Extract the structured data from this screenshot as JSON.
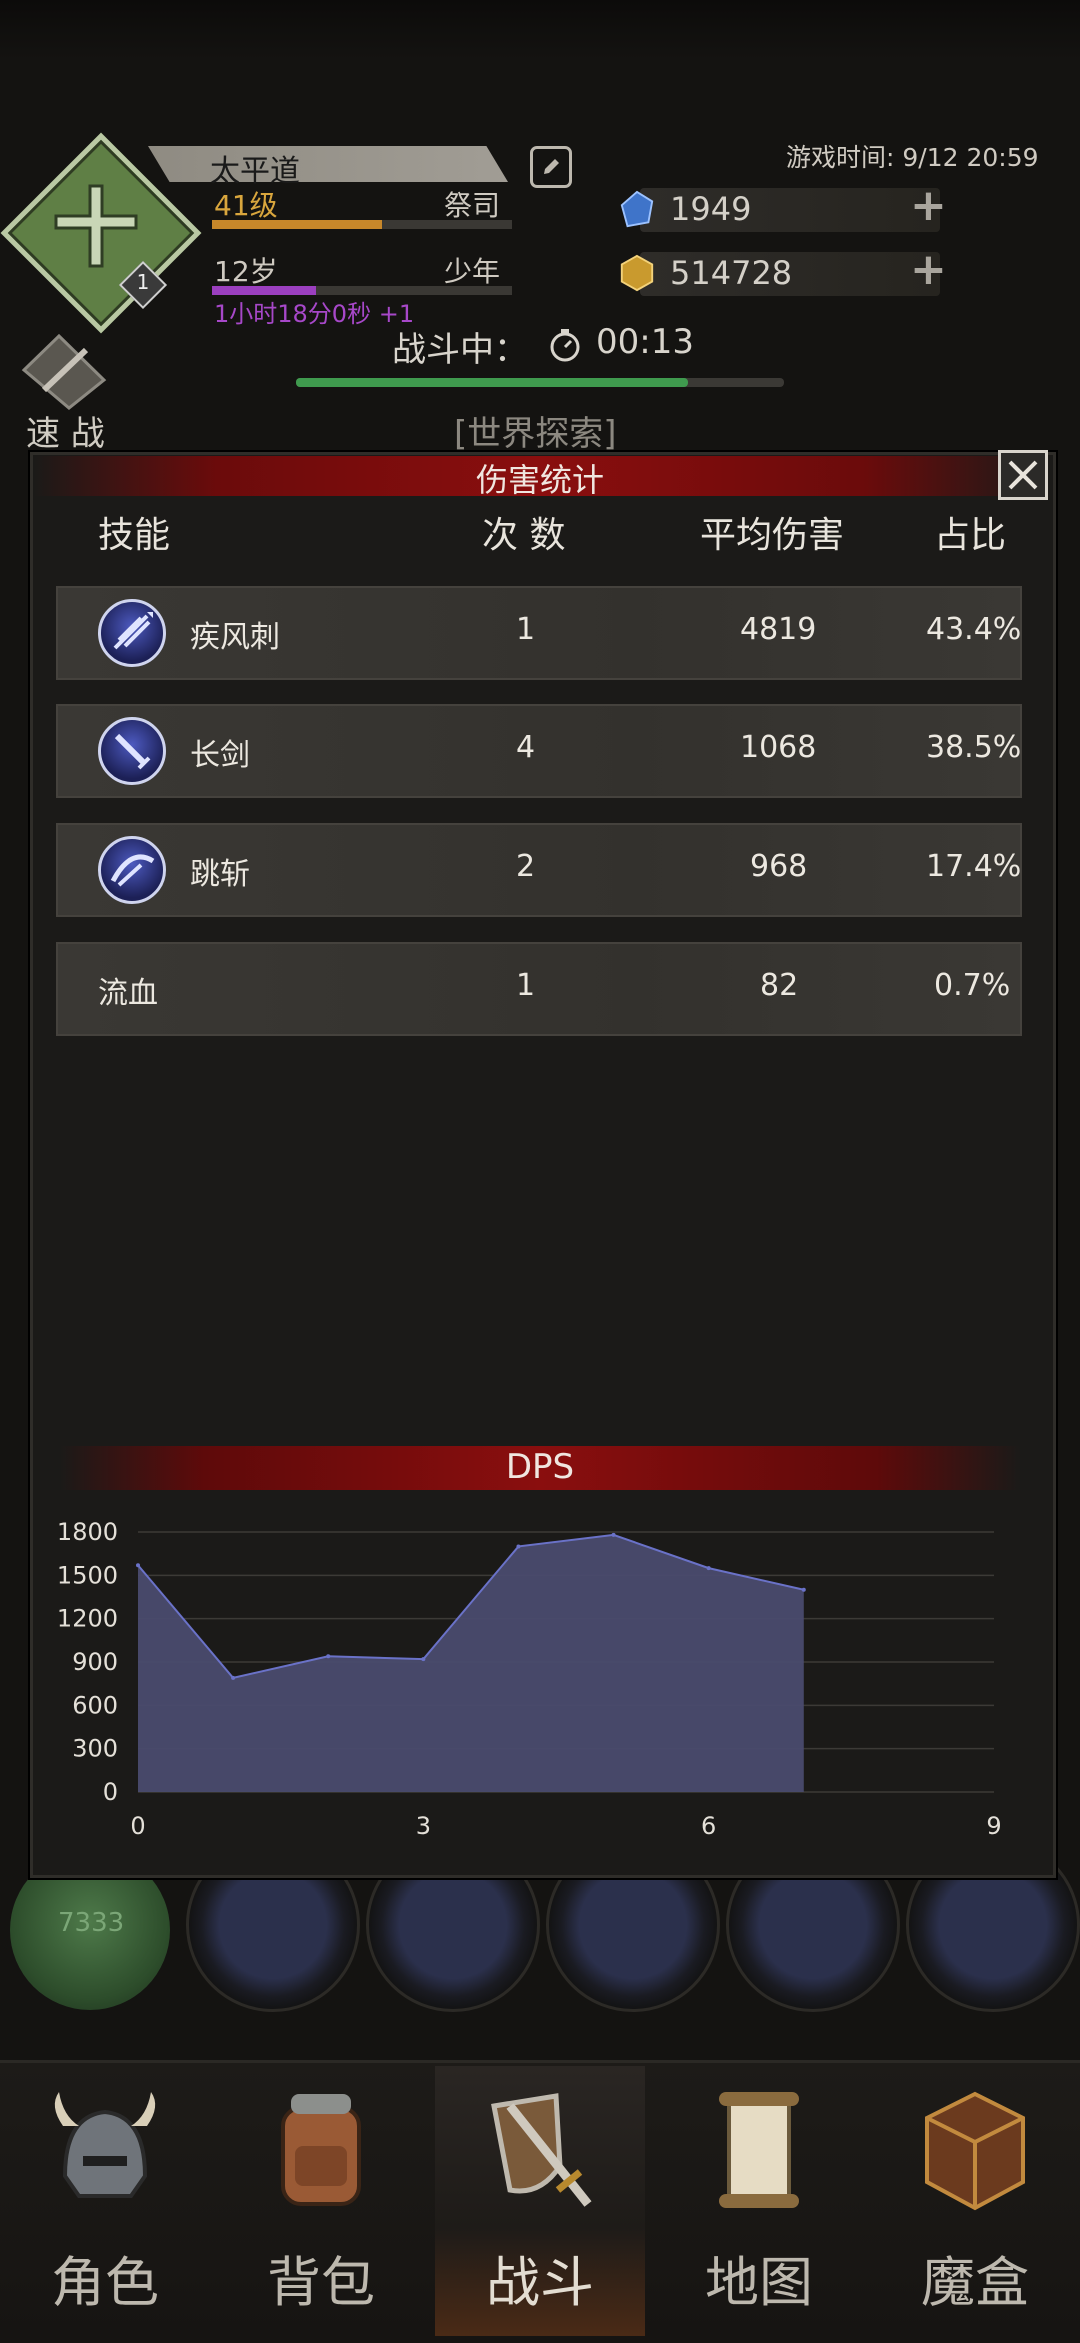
{
  "header": {
    "character_name": "太平道",
    "level": "41级",
    "class": "祭司",
    "age": "12岁",
    "age_stage": "少年",
    "age_timer": "1小时18分0秒 +1",
    "badge_level": "1",
    "game_time": "游戏时间: 9/12 20:59",
    "gems": "1949",
    "gold": "514728",
    "battle_state": "战斗中：",
    "battle_time": "00:13",
    "quick_battle": "速 战",
    "world_explore": "[世界探索]"
  },
  "damage_stats": {
    "title": "伤害统计",
    "columns": {
      "skill": "技能",
      "count": "次 数",
      "avg_damage": "平均伤害",
      "ratio": "占比"
    },
    "rows": [
      {
        "skill": "疾风刺",
        "count": "1",
        "avg": "4819",
        "ratio": "43.4%",
        "icon": "wind-thrust-icon"
      },
      {
        "skill": "长剑",
        "count": "4",
        "avg": "1068",
        "ratio": "38.5%",
        "icon": "longsword-icon"
      },
      {
        "skill": "跳斩",
        "count": "2",
        "avg": "968",
        "ratio": "17.4%",
        "icon": "leap-slash-icon"
      },
      {
        "skill": "流血",
        "count": "1",
        "avg": "82",
        "ratio": "0.7%",
        "icon": ""
      }
    ]
  },
  "chart_data": {
    "type": "area",
    "title": "DPS",
    "xlabel": "",
    "ylabel": "",
    "x": [
      0,
      1,
      2,
      3,
      4,
      5,
      6,
      7
    ],
    "values": [
      1570,
      790,
      940,
      920,
      1700,
      1780,
      1550,
      1400
    ],
    "xlim": [
      0,
      9
    ],
    "ylim": [
      0,
      1800
    ],
    "xticks": [
      0,
      3,
      6,
      9
    ],
    "yticks": [
      0,
      300,
      600,
      900,
      1200,
      1500,
      1800
    ],
    "grid": true,
    "color": "#4a4b6e",
    "line_color": "#6a72c8"
  },
  "background": {
    "hp_value": "7333"
  },
  "nav": {
    "items": [
      {
        "label": "角色",
        "icon": "helmet-icon"
      },
      {
        "label": "背包",
        "icon": "backpack-icon"
      },
      {
        "label": "战斗",
        "icon": "shield-sword-icon",
        "active": true
      },
      {
        "label": "地图",
        "icon": "scroll-map-icon"
      },
      {
        "label": "魔盒",
        "icon": "magic-box-icon"
      }
    ]
  }
}
